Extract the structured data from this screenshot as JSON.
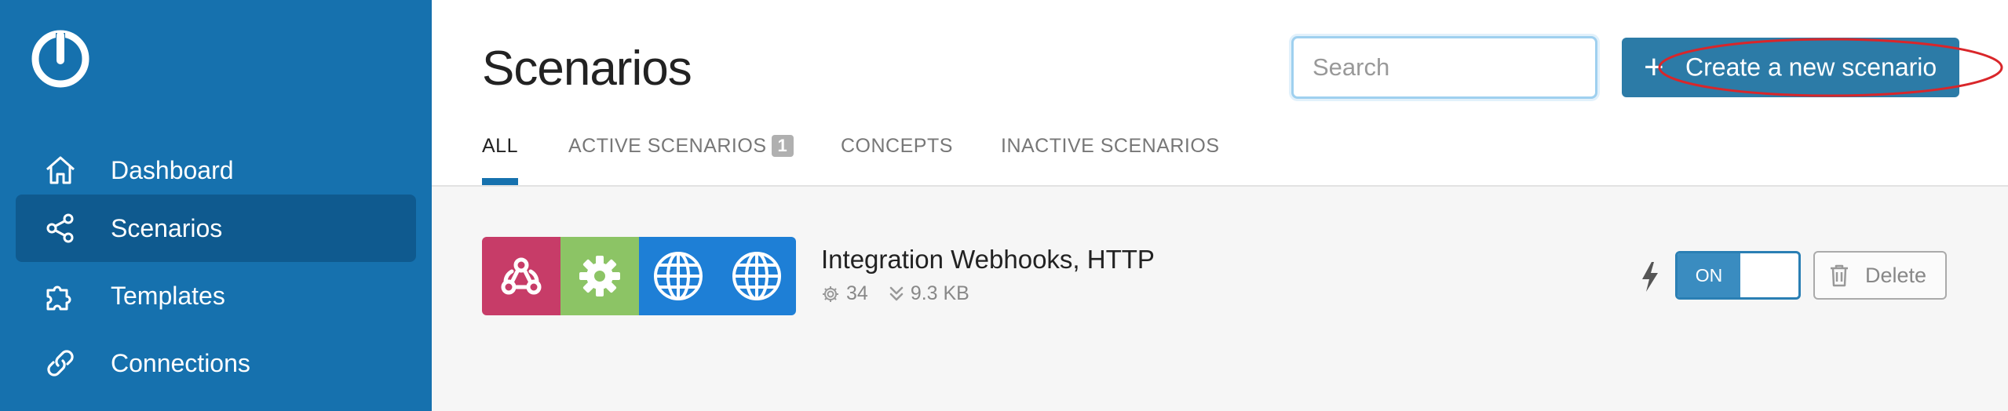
{
  "sidebar": {
    "logo": "integromat-logo",
    "items": [
      {
        "label": "Dashboard",
        "icon": "home-icon",
        "active": false
      },
      {
        "label": "Scenarios",
        "icon": "share-nodes-icon",
        "active": true
      },
      {
        "label": "Templates",
        "icon": "puzzle-icon",
        "active": false
      },
      {
        "label": "Connections",
        "icon": "link-icon",
        "active": false
      }
    ]
  },
  "header": {
    "title": "Scenarios",
    "search_placeholder": "Search",
    "create_button": {
      "icon": "plus-icon",
      "label": "Create a new scenario"
    }
  },
  "tabs": [
    {
      "label": "ALL",
      "active": true
    },
    {
      "label": "ACTIVE SCENARIOS",
      "badge": "1",
      "active": false
    },
    {
      "label": "CONCEPTS",
      "active": false
    },
    {
      "label": "INACTIVE SCENARIOS",
      "active": false
    }
  ],
  "scenarios": [
    {
      "name": "Integration Webhooks, HTTP",
      "operations": "34",
      "data_size": "9.3 KB",
      "apps": [
        {
          "icon": "webhook-icon",
          "color": "#c73c68"
        },
        {
          "icon": "gear-icon",
          "color": "#8cc465"
        },
        {
          "icon": "globe-icon",
          "color": "#1e7fd6"
        },
        {
          "icon": "globe-icon",
          "color": "#1e7fd6"
        }
      ],
      "toggle_label": "ON",
      "toggle_state": "on",
      "delete_label": "Delete"
    }
  ],
  "colors": {
    "sidebar_bg": "#1671ae",
    "sidebar_active": "#0f5a8f",
    "primary_button": "#2c7ba7",
    "annotation_circle": "#d9262a"
  }
}
